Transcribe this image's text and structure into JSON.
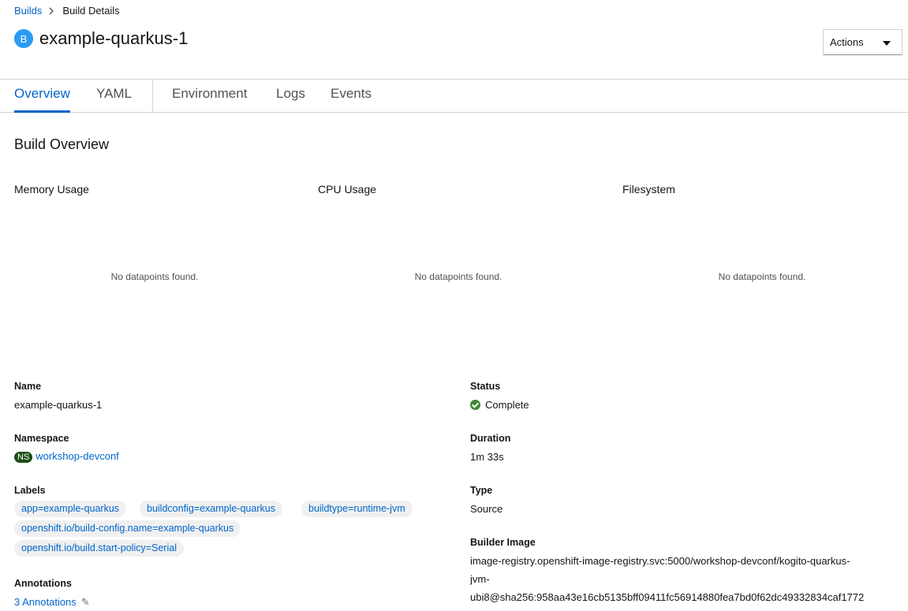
{
  "breadcrumb": {
    "parent": "Builds",
    "current": "Build Details"
  },
  "header": {
    "badge": "B",
    "title": "example-quarkus-1",
    "actions_label": "Actions"
  },
  "tabs": [
    {
      "label": "Overview",
      "active": true
    },
    {
      "label": "YAML"
    },
    {
      "label": "Environment"
    },
    {
      "label": "Logs"
    },
    {
      "label": "Events"
    }
  ],
  "overview": {
    "title": "Build Overview",
    "charts": [
      {
        "title": "Memory Usage",
        "empty": "No datapoints found."
      },
      {
        "title": "CPU Usage",
        "empty": "No datapoints found."
      },
      {
        "title": "Filesystem",
        "empty": "No datapoints found."
      }
    ]
  },
  "details": {
    "name_label": "Name",
    "name_value": "example-quarkus-1",
    "namespace_label": "Namespace",
    "namespace_badge": "NS",
    "namespace_value": "workshop-devconf",
    "labels_label": "Labels",
    "labels": [
      "app=example-quarkus",
      "buildconfig=example-quarkus",
      "buildtype=runtime-jvm",
      "openshift.io/build-config.name=example-quarkus",
      "openshift.io/build.start-policy=Serial"
    ],
    "annotations_label": "Annotations",
    "annotations_value": "3 Annotations",
    "status_label": "Status",
    "status_value": "Complete",
    "duration_label": "Duration",
    "duration_value": "1m 33s",
    "type_label": "Type",
    "type_value": "Source",
    "builder_image_label": "Builder Image",
    "builder_image_lines": [
      "image-registry.openshift-image-registry.svc:5000/workshop-devconf/kogito-quarkus-",
      "jvm-",
      "ubi8@sha256:958aa43e16cb5135bff09411fc56914880fea7bd0f62dc49332834caf1772"
    ]
  },
  "colors": {
    "link": "#0066cc",
    "status_success": "#3e8635",
    "ns_badge": "#1e4f18",
    "resource_badge": "#2b9af3"
  }
}
